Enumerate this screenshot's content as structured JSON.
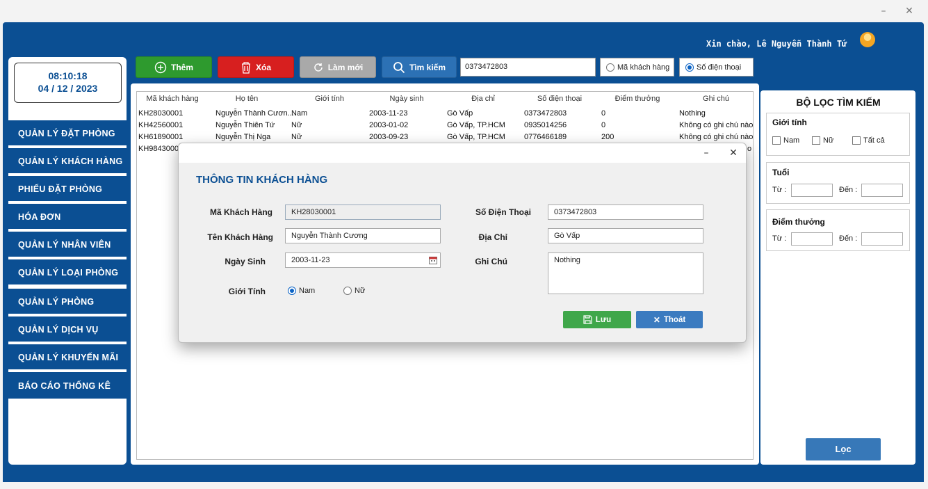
{
  "window": {
    "minimize": "–",
    "close": "✕"
  },
  "header": {
    "greeting": "Xin chào, Lê Nguyễn Thành Tứ"
  },
  "clock": {
    "time": "08:10:18",
    "date": "04 / 12 / 2023"
  },
  "sidebar": {
    "items": [
      {
        "label": "QUẢN LÝ ĐẶT PHÒNG"
      },
      {
        "label": "QUẢN LÝ KHÁCH HÀNG"
      },
      {
        "label": "PHIẾU ĐẶT PHÒNG"
      },
      {
        "label": "HÓA ĐƠN"
      },
      {
        "label": "QUẢN LÝ NHÂN VIÊN"
      },
      {
        "label": "QUẢN LÝ LOẠI PHÒNG"
      },
      {
        "label": "QUẢN LÝ PHÒNG"
      },
      {
        "label": "QUẢN LÝ DỊCH VỤ"
      },
      {
        "label": "QUẢN LÝ KHUYẾN MÃI"
      },
      {
        "label": "BÁO CÁO THỐNG KÊ"
      }
    ]
  },
  "toolbar": {
    "add_label": "Thêm",
    "delete_label": "Xóa",
    "refresh_label": "Làm mới",
    "search_label": "Tìm kiếm",
    "search_value": "0373472803",
    "radio_code": "Mã khách hàng",
    "radio_phone": "Số điện thoại",
    "selected": "Số điện thoại"
  },
  "table": {
    "columns": [
      "Mã khách hàng",
      "Họ tên",
      "Giới tính",
      "Ngày sinh",
      "Địa chỉ",
      "Số điện thoại",
      "Điểm thưởng",
      "Ghi chú"
    ],
    "rows": [
      [
        "KH28030001",
        "Nguyễn Thành Cươn...",
        "Nam",
        "2003-11-23",
        "Gò Vấp",
        "0373472803",
        "0",
        "Nothing"
      ],
      [
        "KH42560001",
        "Nguyễn Thiên Tứ",
        "Nữ",
        "2003-01-02",
        "Gò Vấp, TP.HCM",
        "0935014256",
        "0",
        "Không có ghi chú nào"
      ],
      [
        "KH61890001",
        "Nguyễn Thị Nga",
        "Nữ",
        "2003-09-23",
        "Gò Vấp, TP.HCM",
        "0776466189",
        "200",
        "Không có ghi chú nào"
      ],
      [
        "KH98430001",
        "",
        "",
        "",
        "",
        "",
        "",
        "o"
      ]
    ]
  },
  "filter": {
    "title": "BỘ LỌC TÌM KIẾM",
    "gender_title": "Giới tính",
    "gender_male": "Nam",
    "gender_female": "Nữ",
    "gender_all": "Tất cả",
    "age_title": "Tuổi",
    "points_title": "Điểm thưởng",
    "from_label": "Từ :",
    "to_label": "Đến :",
    "button": "Lọc"
  },
  "dialog": {
    "minimize": "–",
    "close": "✕",
    "heading": "THÔNG TIN KHÁCH HÀNG",
    "code_label": "Mã Khách Hàng",
    "code_value": "KH28030001",
    "name_label": "Tên Khách Hàng",
    "name_value": "Nguyễn Thành Cương",
    "dob_label": "Ngày Sinh",
    "dob_value": "2003-11-23",
    "gender_label": "Giới Tính",
    "gender_male": "Nam",
    "gender_female": "Nữ",
    "gender_selected": "Nam",
    "phone_label": "Số Điện Thoại",
    "phone_value": "0373472803",
    "address_label": "Địa Chỉ",
    "address_value": "Gò Vấp",
    "note_label": "Ghi Chú",
    "note_value": "Nothing",
    "save_label": "Lưu",
    "exit_label": "Thoát"
  },
  "colors": {
    "brand": "#0b4f93",
    "add": "#2e9a2e",
    "delete": "#d71f1f",
    "refresh": "#a9a9a9",
    "search": "#2c71b5",
    "save": "#3fa74a",
    "exit": "#3b7bc0",
    "filter_button": "#3778b8"
  }
}
